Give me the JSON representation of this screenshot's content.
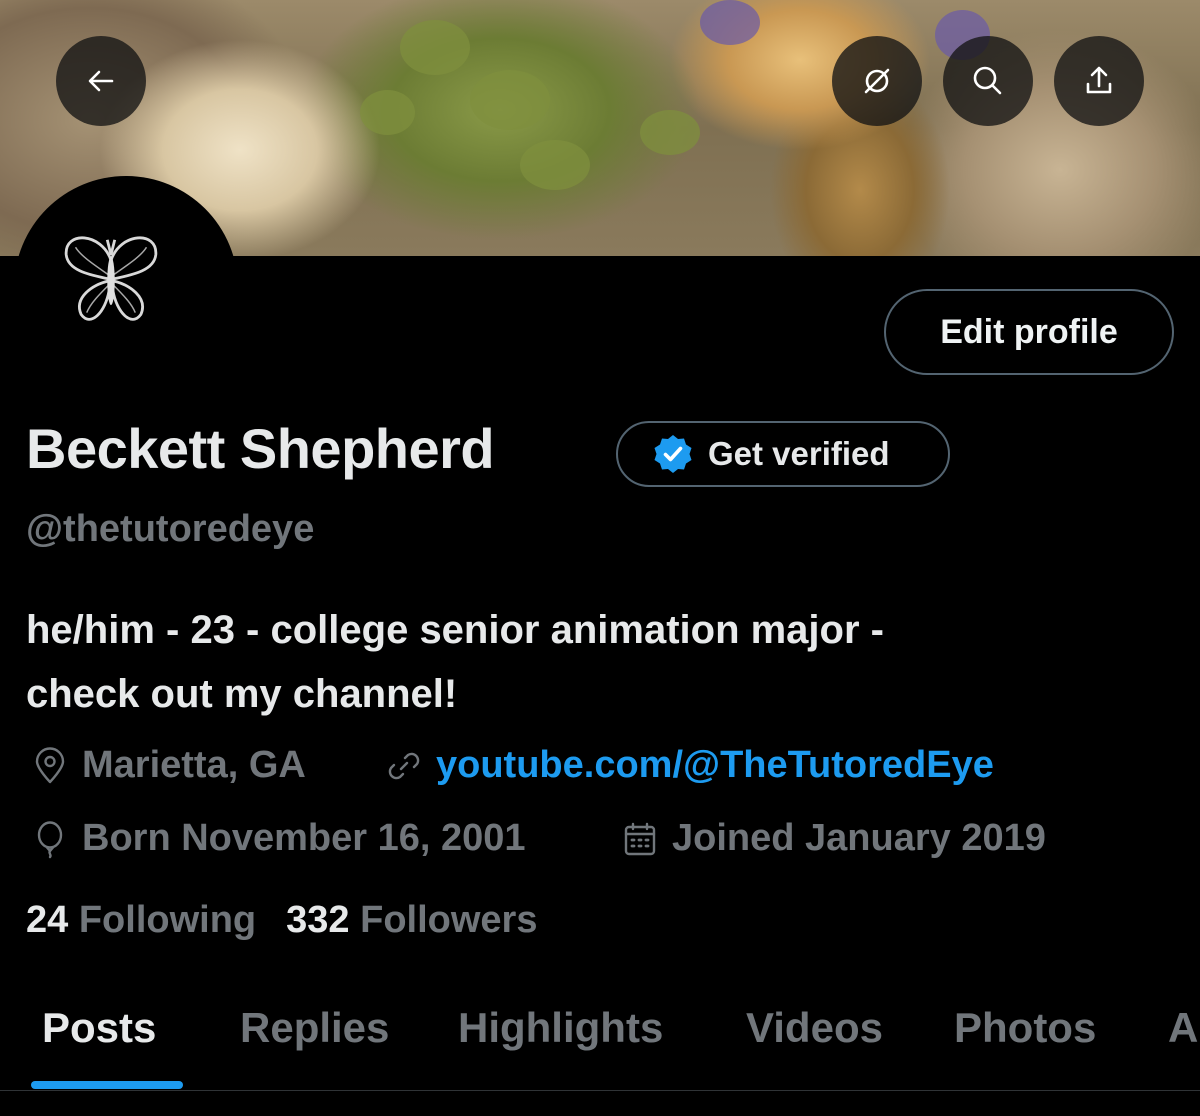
{
  "header": {
    "back_icon": "arrow-left-icon",
    "actions": [
      {
        "icon": "broken-link-icon"
      },
      {
        "icon": "search-icon"
      },
      {
        "icon": "share-icon"
      }
    ]
  },
  "profile": {
    "avatar_icon": "butterfly-icon",
    "edit_label": "Edit profile",
    "name": "Beckett Shepherd",
    "verify_label": "Get verified",
    "handle": "@thetutoredeye",
    "bio_line1": "he/him - 23 - college senior animation major -",
    "bio_line2": "check out my channel!",
    "location": "Marietta, GA",
    "website": "youtube.com/@TheTutoredEye",
    "born": "Born November 16, 2001",
    "joined": "Joined January 2019",
    "following_count": "24",
    "following_label": "Following",
    "followers_count": "332",
    "followers_label": "Followers"
  },
  "tabs": [
    {
      "label": "Posts",
      "active": true
    },
    {
      "label": "Replies"
    },
    {
      "label": "Highlights"
    },
    {
      "label": "Videos"
    },
    {
      "label": "Photos"
    },
    {
      "label": "A"
    }
  ],
  "colors": {
    "accent": "#1d9bf0",
    "muted": "#71767b",
    "text": "#e7e9ea",
    "border": "#536471"
  }
}
